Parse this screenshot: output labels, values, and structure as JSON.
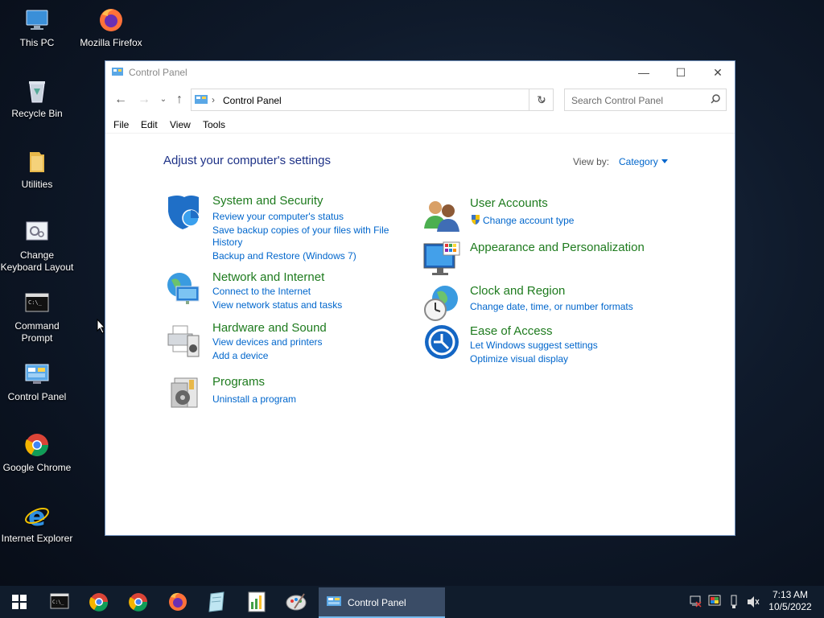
{
  "desktop": {
    "icons": [
      {
        "label": "This PC",
        "icon": "this-pc-icon"
      },
      {
        "label": "Mozilla Firefox",
        "icon": "firefox-icon"
      },
      {
        "label": "Recycle Bin",
        "icon": "recycle-bin-icon"
      },
      {
        "label": "Utilities",
        "icon": "folder-icon"
      },
      {
        "label": "Change Keyboard Layout",
        "icon": "keyboard-settings-icon"
      },
      {
        "label": "Command Prompt",
        "icon": "command-prompt-icon"
      },
      {
        "label": "Control Panel",
        "icon": "control-panel-icon"
      },
      {
        "label": "Google Chrome",
        "icon": "chrome-icon"
      },
      {
        "label": "Internet Explorer",
        "icon": "internet-explorer-icon"
      }
    ]
  },
  "window": {
    "title": "Control Panel",
    "minimize": "—",
    "maximize": "☐",
    "close": "✕",
    "address": {
      "crumb": "Control Panel",
      "separator": "›"
    },
    "search": {
      "placeholder": "Search Control Panel"
    },
    "menu": [
      "File",
      "Edit",
      "View",
      "Tools"
    ],
    "heading": "Adjust your computer's settings",
    "view_by_label": "View by:",
    "view_by_value": "Category",
    "categories": [
      {
        "title": "System and Security",
        "links": [
          "Review your computer's status",
          "Save backup copies of your files with File",
          "History",
          "Backup and Restore (Windows 7)"
        ]
      },
      {
        "title": "Network and Internet",
        "links": [
          "Connect to the Internet",
          "View network status and tasks"
        ]
      },
      {
        "title": "Hardware and Sound",
        "links": [
          "View devices and printers",
          "Add a device"
        ]
      },
      {
        "title": "Programs",
        "links": [
          "Uninstall a program"
        ]
      },
      {
        "title": "User Accounts",
        "links": [
          "Change account type"
        ]
      },
      {
        "title": "Appearance and Personalization",
        "links": []
      },
      {
        "title": "Clock and Region",
        "links": [
          "Change date, time, or number formats"
        ]
      },
      {
        "title": "Ease of Access",
        "links": [
          "Let Windows suggest settings",
          "Optimize visual display"
        ]
      }
    ]
  },
  "taskbar": {
    "active_label": "Control Panel",
    "clock": {
      "time": "7:13 AM",
      "date": "10/5/2022"
    },
    "colors": {
      "bg": "#101c2c",
      "accent": "#76b9ed"
    }
  }
}
